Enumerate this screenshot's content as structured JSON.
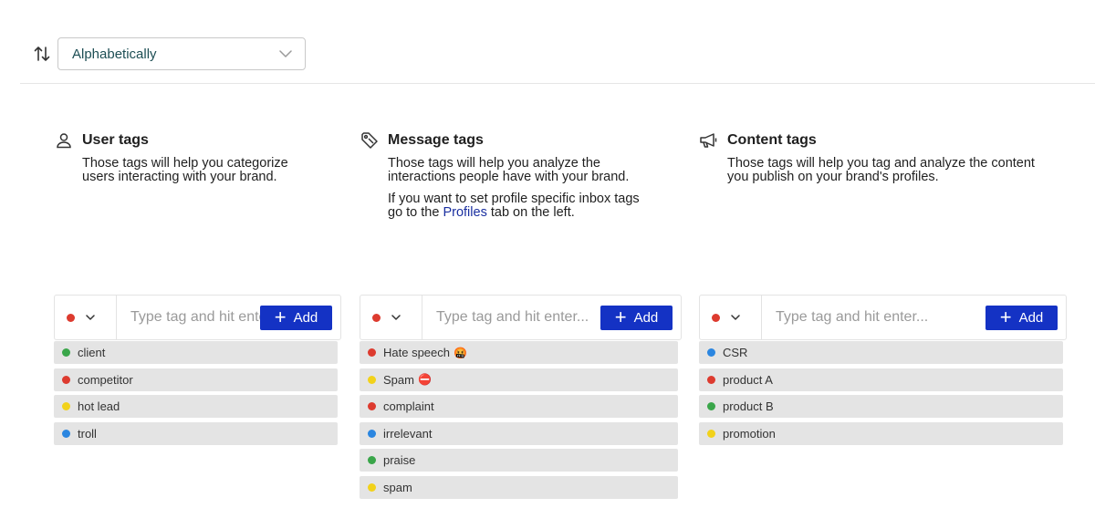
{
  "sort": {
    "icon": "sort-arrows-icon",
    "selected": "Alphabetically"
  },
  "colors": {
    "red": "#dd3b2f",
    "green": "#3aa64a",
    "yellow": "#f2d21b",
    "blue": "#2b86e0",
    "accent": "#1432c4",
    "link": "#1a2fa0"
  },
  "columns": [
    {
      "icon": "user-icon",
      "title": "User tags",
      "description": "Those tags will help you categorize\nusers interacting with your brand.",
      "input_placeholder": "Type tag and hit enter...",
      "add_label": "Add",
      "selected_color": "red",
      "tags": [
        {
          "label": "client",
          "color": "green"
        },
        {
          "label": "competitor",
          "color": "red"
        },
        {
          "label": "hot lead",
          "color": "yellow"
        },
        {
          "label": "troll",
          "color": "blue"
        }
      ]
    },
    {
      "icon": "tag-icon",
      "title": "Message tags",
      "description": "Those tags will help you analyze the\ninteractions people have with your brand.",
      "note_before": "If you want to set profile specific inbox tags\ngo to the ",
      "note_link": "Profiles",
      "note_after": " tab on the left.",
      "input_placeholder": "Type tag and hit enter...",
      "add_label": "Add",
      "selected_color": "red",
      "tags": [
        {
          "label": "Hate speech",
          "color": "red",
          "emoji": "🤬"
        },
        {
          "label": "Spam",
          "color": "yellow",
          "emoji": "⛔"
        },
        {
          "label": "complaint",
          "color": "red"
        },
        {
          "label": "irrelevant",
          "color": "blue"
        },
        {
          "label": "praise",
          "color": "green"
        },
        {
          "label": "spam",
          "color": "yellow"
        }
      ]
    },
    {
      "icon": "megaphone-icon",
      "title": "Content tags",
      "description": "Those tags will help you tag and analyze the content\nyou publish on your brand's profiles.",
      "input_placeholder": "Type tag and hit enter...",
      "add_label": "Add",
      "selected_color": "red",
      "tags": [
        {
          "label": "CSR",
          "color": "blue"
        },
        {
          "label": "product A",
          "color": "red"
        },
        {
          "label": "product B",
          "color": "green"
        },
        {
          "label": "promotion",
          "color": "yellow"
        }
      ]
    }
  ]
}
